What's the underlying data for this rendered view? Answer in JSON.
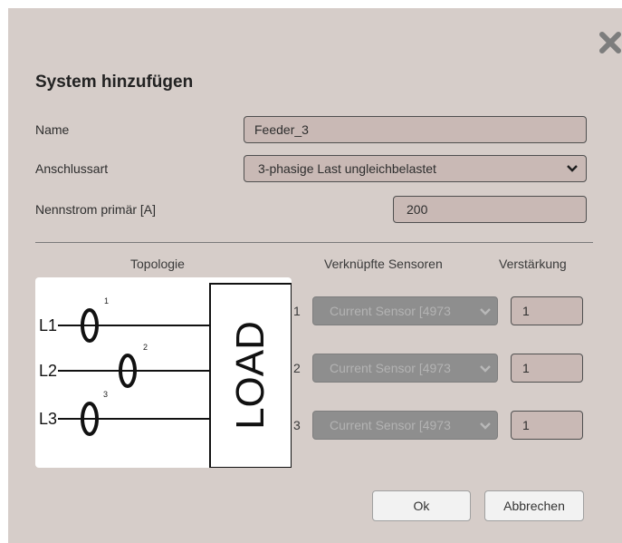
{
  "dialog": {
    "title": "System hinzufügen",
    "close_icon": "close-x-icon"
  },
  "form": {
    "name_label": "Name",
    "name_value": "Feeder_3",
    "connection_label": "Anschlussart",
    "connection_value": "3-phasige Last ungleichbelastet",
    "current_label": "Nennstrom primär [A]",
    "current_value": "200"
  },
  "table": {
    "col_topology": "Topologie",
    "col_sensors": "Verknüpfte Sensoren",
    "col_gain": "Verstärkung",
    "rows": [
      {
        "num": "1",
        "sensor": "Current Sensor [4973",
        "gain": "1"
      },
      {
        "num": "2",
        "sensor": "Current Sensor [4973",
        "gain": "1"
      },
      {
        "num": "3",
        "sensor": "Current Sensor [4973",
        "gain": "1"
      }
    ]
  },
  "diagram": {
    "phases": [
      "L1",
      "L2",
      "L3"
    ],
    "sensor_marks": [
      "1",
      "2",
      "3"
    ],
    "load_label": "LOAD"
  },
  "buttons": {
    "ok": "Ok",
    "cancel": "Abbrechen"
  },
  "colors": {
    "dialog_bg": "#d6cdc9",
    "input_bg": "#c9b9b5",
    "disabled_select_bg": "#8e8e8e"
  }
}
